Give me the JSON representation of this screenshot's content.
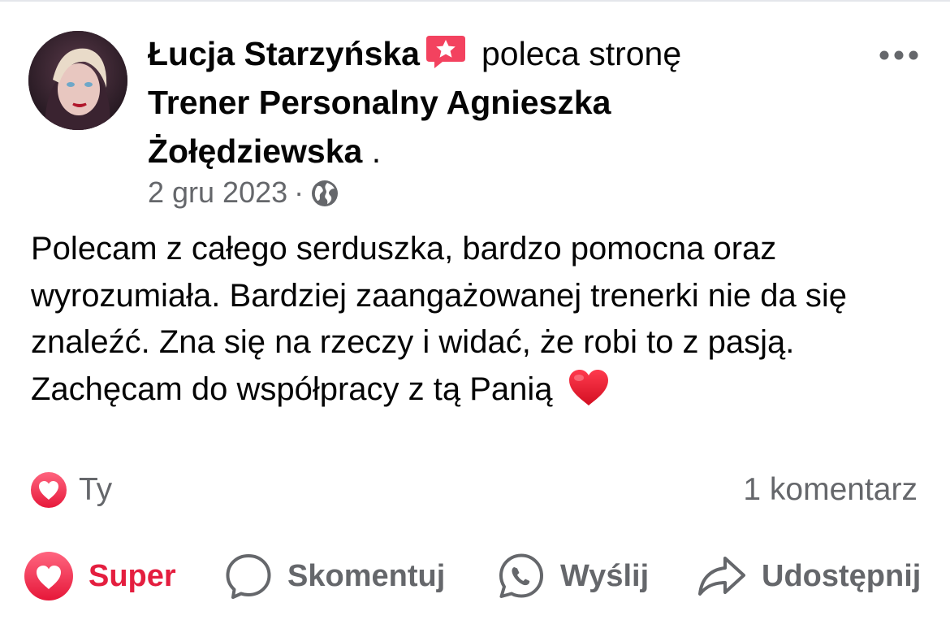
{
  "post": {
    "author": "Łucja Starzyńska",
    "action": "poleca stronę",
    "page_name_line1": "Trener Personalny Agnieszka",
    "page_name_line2": "Żołędziewska",
    "page_name_suffix": " .",
    "date": "2 gru 2023",
    "separator": "·",
    "privacy_icon": "globe-icon",
    "recommend_icon": "recommend-star-badge-icon",
    "more_icon": "more-options-icon",
    "body_paragraphs": [
      "Polecam z całego serduszka, bardzo pomocna oraz wyrozumiała. Bardziej zaangażowanej trenerki nie da się znaleźć. Zna się na rzeczy i widać, że robi to z pasją.",
      "Zachęcam do współpracy z tą Panią"
    ],
    "body_emoji": "red-heart-emoji"
  },
  "reactions": {
    "icon": "love-reaction-icon",
    "who": "Ty",
    "comment_count": "1 komentarz"
  },
  "actions": {
    "super_label": "Super",
    "comment_label": "Skomentuj",
    "send_label": "Wyślij",
    "share_label": "Udostępnij"
  },
  "colors": {
    "love_red": "#e41e3f",
    "badge_pink": "#f3425f",
    "secondary_text": "#65676b",
    "primary_text": "#050505"
  }
}
